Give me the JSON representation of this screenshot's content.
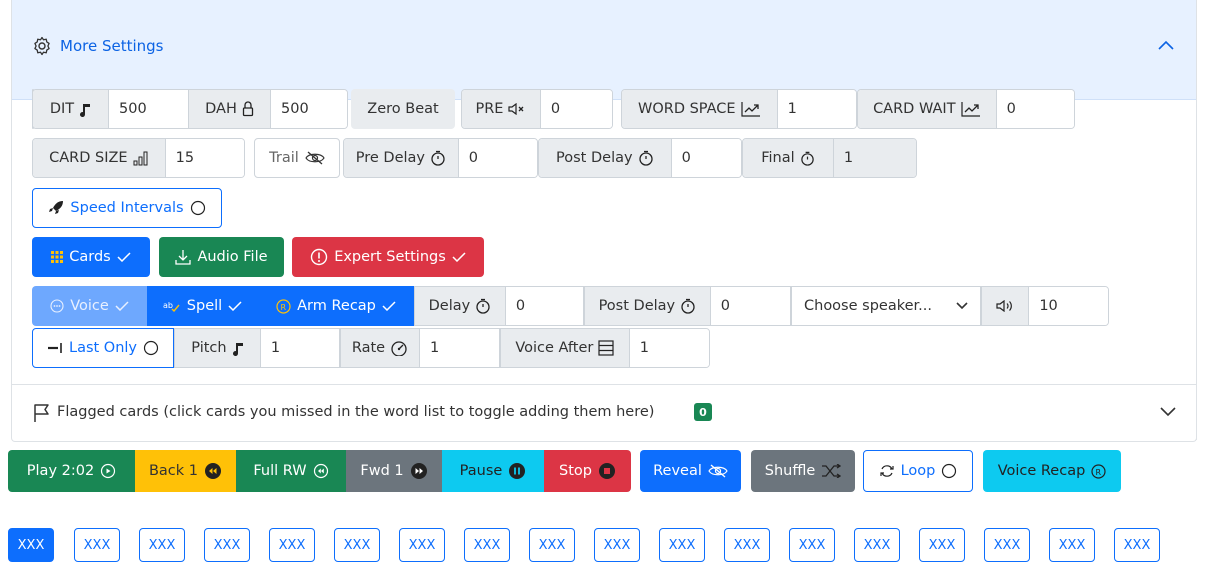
{
  "settings": {
    "title": "More Settings",
    "icon": "gear-icon",
    "dit": {
      "label": "DIT",
      "value": "500"
    },
    "dah": {
      "label": "DAH",
      "value": "500"
    },
    "zero_beat": "Zero Beat",
    "pre": {
      "label": "PRE",
      "value": "0"
    },
    "word_space": {
      "label": "WORD SPACE",
      "value": "1"
    },
    "card_wait": {
      "label": "CARD WAIT",
      "value": "0"
    },
    "card_size": {
      "label": "CARD SIZE",
      "value": "15"
    },
    "trail": "Trail",
    "pre_delay": {
      "label": "Pre Delay",
      "value": "0"
    },
    "post_delay": {
      "label": "Post Delay",
      "value": "0"
    },
    "final": {
      "label": "Final",
      "value": "1"
    },
    "speed_intervals": "Speed Intervals",
    "cards": "Cards",
    "audio_file": "Audio File",
    "expert_settings": "Expert Settings",
    "voice": "Voice",
    "spell": "Spell",
    "arm_recap": "Arm Recap",
    "voice_delay": {
      "label": "Delay",
      "value": "0"
    },
    "voice_post_delay": {
      "label": "Post Delay",
      "value": "0"
    },
    "speaker": {
      "value": "Choose speaker...",
      "options": [
        "Choose speaker..."
      ]
    },
    "volume": {
      "value": "10"
    },
    "last_only": "Last Only",
    "pitch": {
      "label": "Pitch",
      "value": "1"
    },
    "rate": {
      "label": "Rate",
      "value": "1"
    },
    "voice_after": {
      "label": "Voice After",
      "value": "1"
    }
  },
  "flagged": {
    "text": "Flagged cards (click cards you missed in the word list to toggle adding them here)",
    "count": "0"
  },
  "transport": {
    "play": "Play 2:02",
    "back": "Back 1",
    "full_rw": "Full RW",
    "fwd": "Fwd 1",
    "pause": "Pause",
    "stop": "Stop",
    "reveal": "Reveal",
    "shuffle": "Shuffle",
    "loop": "Loop",
    "voice_recap": "Voice Recap"
  },
  "word_cards": [
    "XXX",
    "XXX",
    "XXX",
    "XXX",
    "XXX",
    "XXX",
    "XXX",
    "XXX",
    "XXX",
    "XXX",
    "XXX",
    "XXX",
    "XXX",
    "XXX",
    "XXX",
    "XXX",
    "XXX",
    "XXX"
  ],
  "colors": {
    "primary": "#0d6efd",
    "success": "#198754",
    "danger": "#dc3545",
    "warning": "#ffc107",
    "info": "#0dcaf0",
    "secondary": "#6c757d",
    "accordion_bg": "#e7f1ff"
  }
}
